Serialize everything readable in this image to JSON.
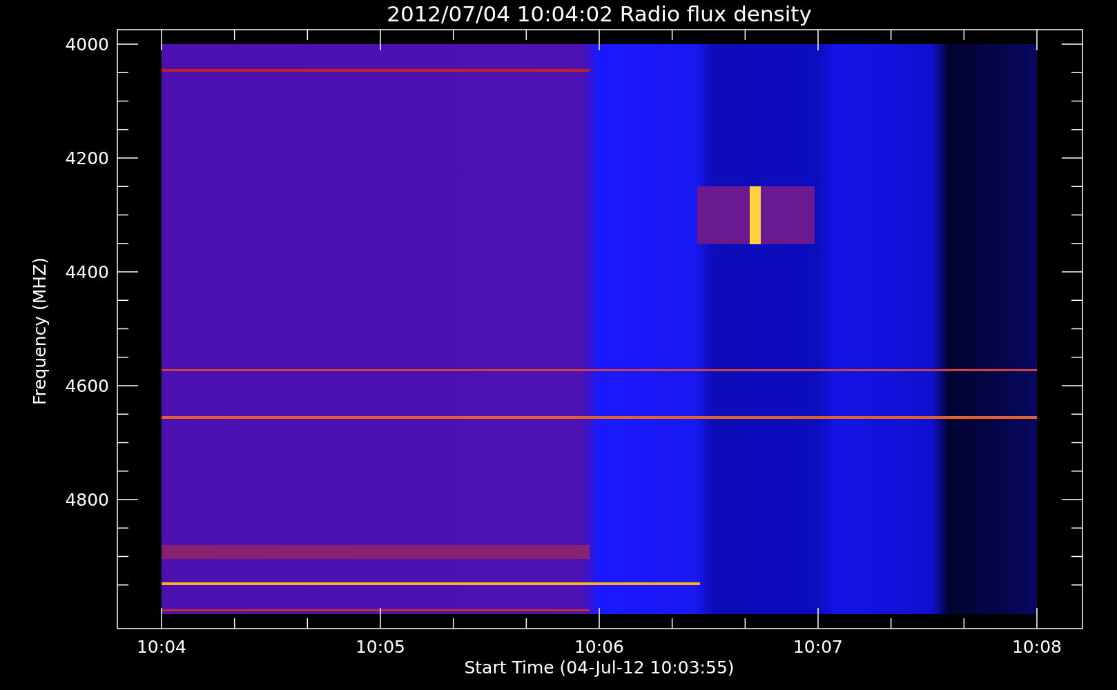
{
  "title": "2012/07/04 10:04:02 Radio flux density",
  "y_axis": {
    "label": "Frequency (MHZ)",
    "ticks": [
      "4000",
      "4200",
      "4400",
      "4600",
      "4800"
    ]
  },
  "x_axis": {
    "label": "Start Time (04-Jul-12 10:03:55)",
    "ticks": [
      "10:04",
      "10:05",
      "10:06",
      "10:07",
      "10:08"
    ]
  }
}
